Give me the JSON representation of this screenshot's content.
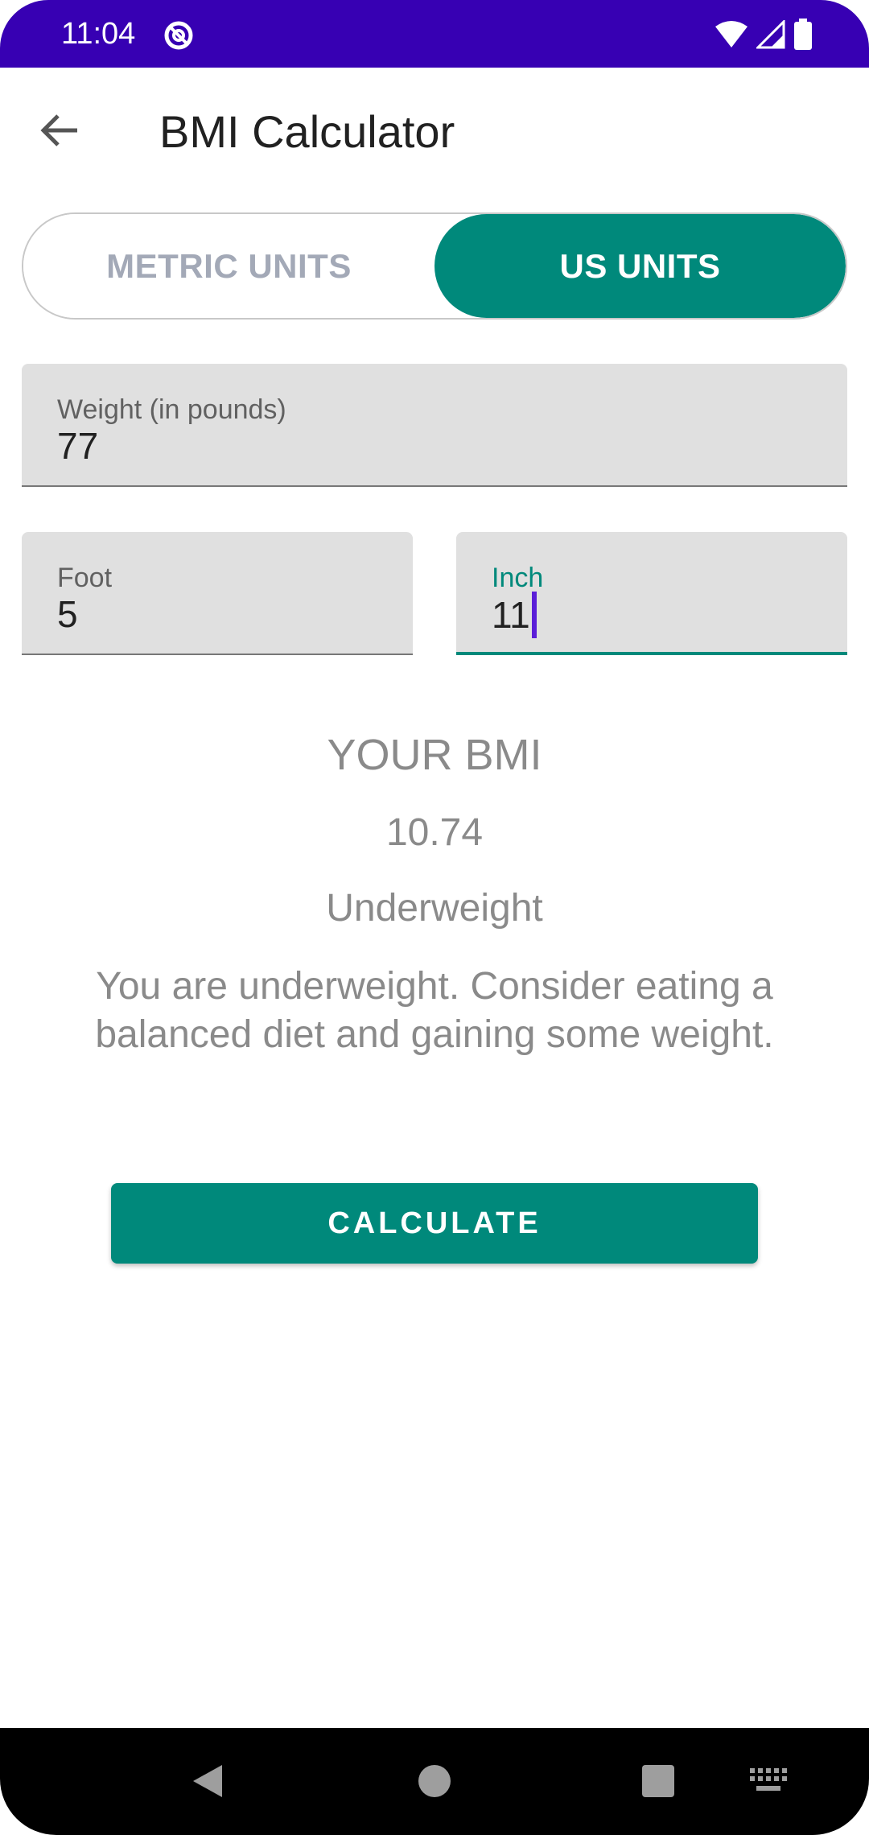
{
  "status_bar": {
    "time": "11:04"
  },
  "app_bar": {
    "title": "BMI Calculator"
  },
  "units_toggle": {
    "metric_label": "METRIC UNITS",
    "us_label": "US UNITS",
    "selected": "US UNITS"
  },
  "fields": {
    "weight": {
      "label": "Weight (in pounds)",
      "value": "77"
    },
    "foot": {
      "label": "Foot",
      "value": "5"
    },
    "inch": {
      "label": "Inch",
      "value": "11"
    }
  },
  "result": {
    "heading": "YOUR BMI",
    "value": "10.74",
    "category": "Underweight",
    "advice": "You are underweight. Consider eating a balanced diet and gaining some weight."
  },
  "actions": {
    "calculate_label": "CALCULATE"
  },
  "colors": {
    "status_bar": "#3700b3",
    "accent": "#00897b",
    "cursor": "#5b1ed8"
  },
  "icons": {
    "back": "arrow-left-icon",
    "nav_back": "triangle-back-icon",
    "nav_home": "circle-home-icon",
    "nav_recents": "square-recents-icon",
    "nav_keyboard": "keyboard-icon"
  }
}
